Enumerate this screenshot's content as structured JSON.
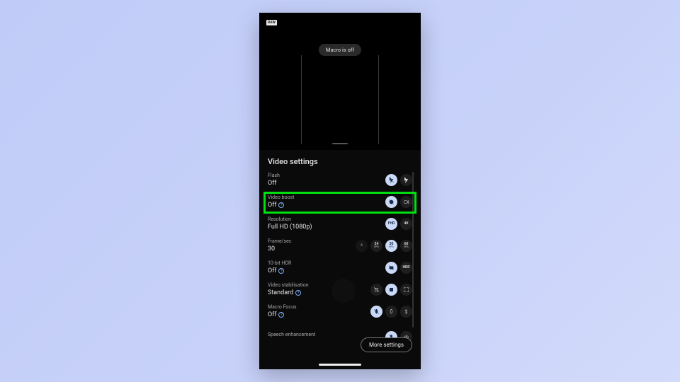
{
  "raw_badge": "RAW",
  "macro_toast": "Macro is off",
  "panel_title": "Video settings",
  "rows": {
    "flash": {
      "label": "Flash",
      "value": "Off"
    },
    "boost": {
      "label": "Video boost",
      "value": "Off"
    },
    "resolution": {
      "label": "Resolution",
      "value": "Full HD (1080p)"
    },
    "framerate": {
      "label": "Frame/sec",
      "value": "30"
    },
    "hdr": {
      "label": "10-bit HDR",
      "value": "Off"
    },
    "stab": {
      "label": "Video stabilisation",
      "value": "Standard"
    },
    "macro": {
      "label": "Macro Focus",
      "value": "Off"
    },
    "speech": {
      "label": "Speech enhancement",
      "value": ""
    }
  },
  "fps_options": [
    "A",
    "24",
    "30",
    "60"
  ],
  "fps_sub": "FPS",
  "res_options": [
    "FHD",
    "4K"
  ],
  "hdr_option": "HDR",
  "more_settings": "More settings",
  "highlight_row": "boost",
  "colors": {
    "selected_bg": "#c9d9f6",
    "selected_fg": "#1a2b4a",
    "highlight": "#00e010"
  }
}
